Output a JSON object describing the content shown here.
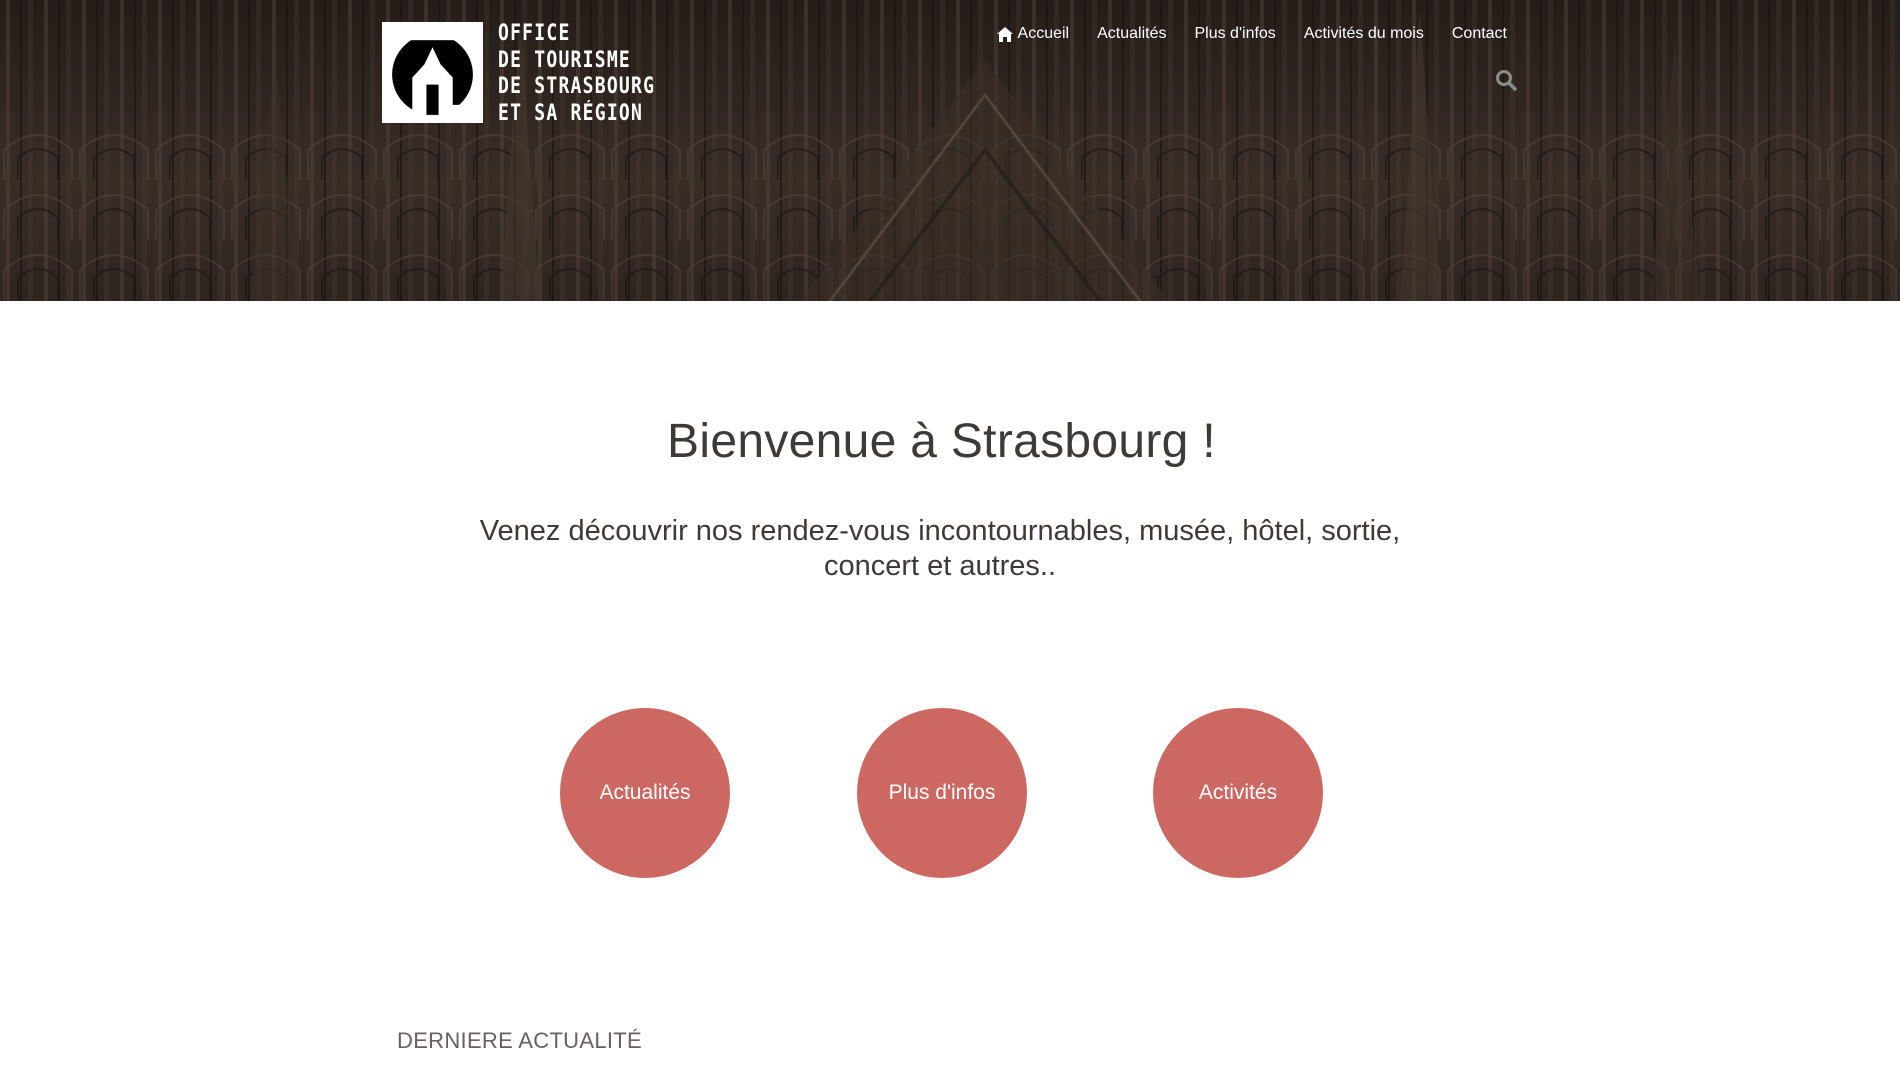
{
  "logo": {
    "lines": [
      "OFFICE",
      "DE TOURISME",
      "DE STRASBOURG",
      "ET SA RÉGION"
    ]
  },
  "nav": {
    "items": [
      {
        "label": "Accueil",
        "icon": "home-icon"
      },
      {
        "label": "Actualités"
      },
      {
        "label": "Plus d'infos"
      },
      {
        "label": "Activités du mois"
      },
      {
        "label": "Contact"
      }
    ],
    "search_icon": "search-icon"
  },
  "main": {
    "title": "Bienvenue à Strasbourg !",
    "subtitle_line1": "Venez découvrir nos rendez-vous incontournables, musée, hôtel, sortie,",
    "subtitle_line2": "concert et autres..",
    "circles": [
      {
        "label": "Actualités"
      },
      {
        "label": "Plus d'infos"
      },
      {
        "label": "Activités"
      }
    ],
    "section_heading": "DERNIERE ACTUALITÉ"
  },
  "colors": {
    "accent": "#cd6761",
    "text": "#3e3a38",
    "hero_dark": "#2a211c"
  }
}
